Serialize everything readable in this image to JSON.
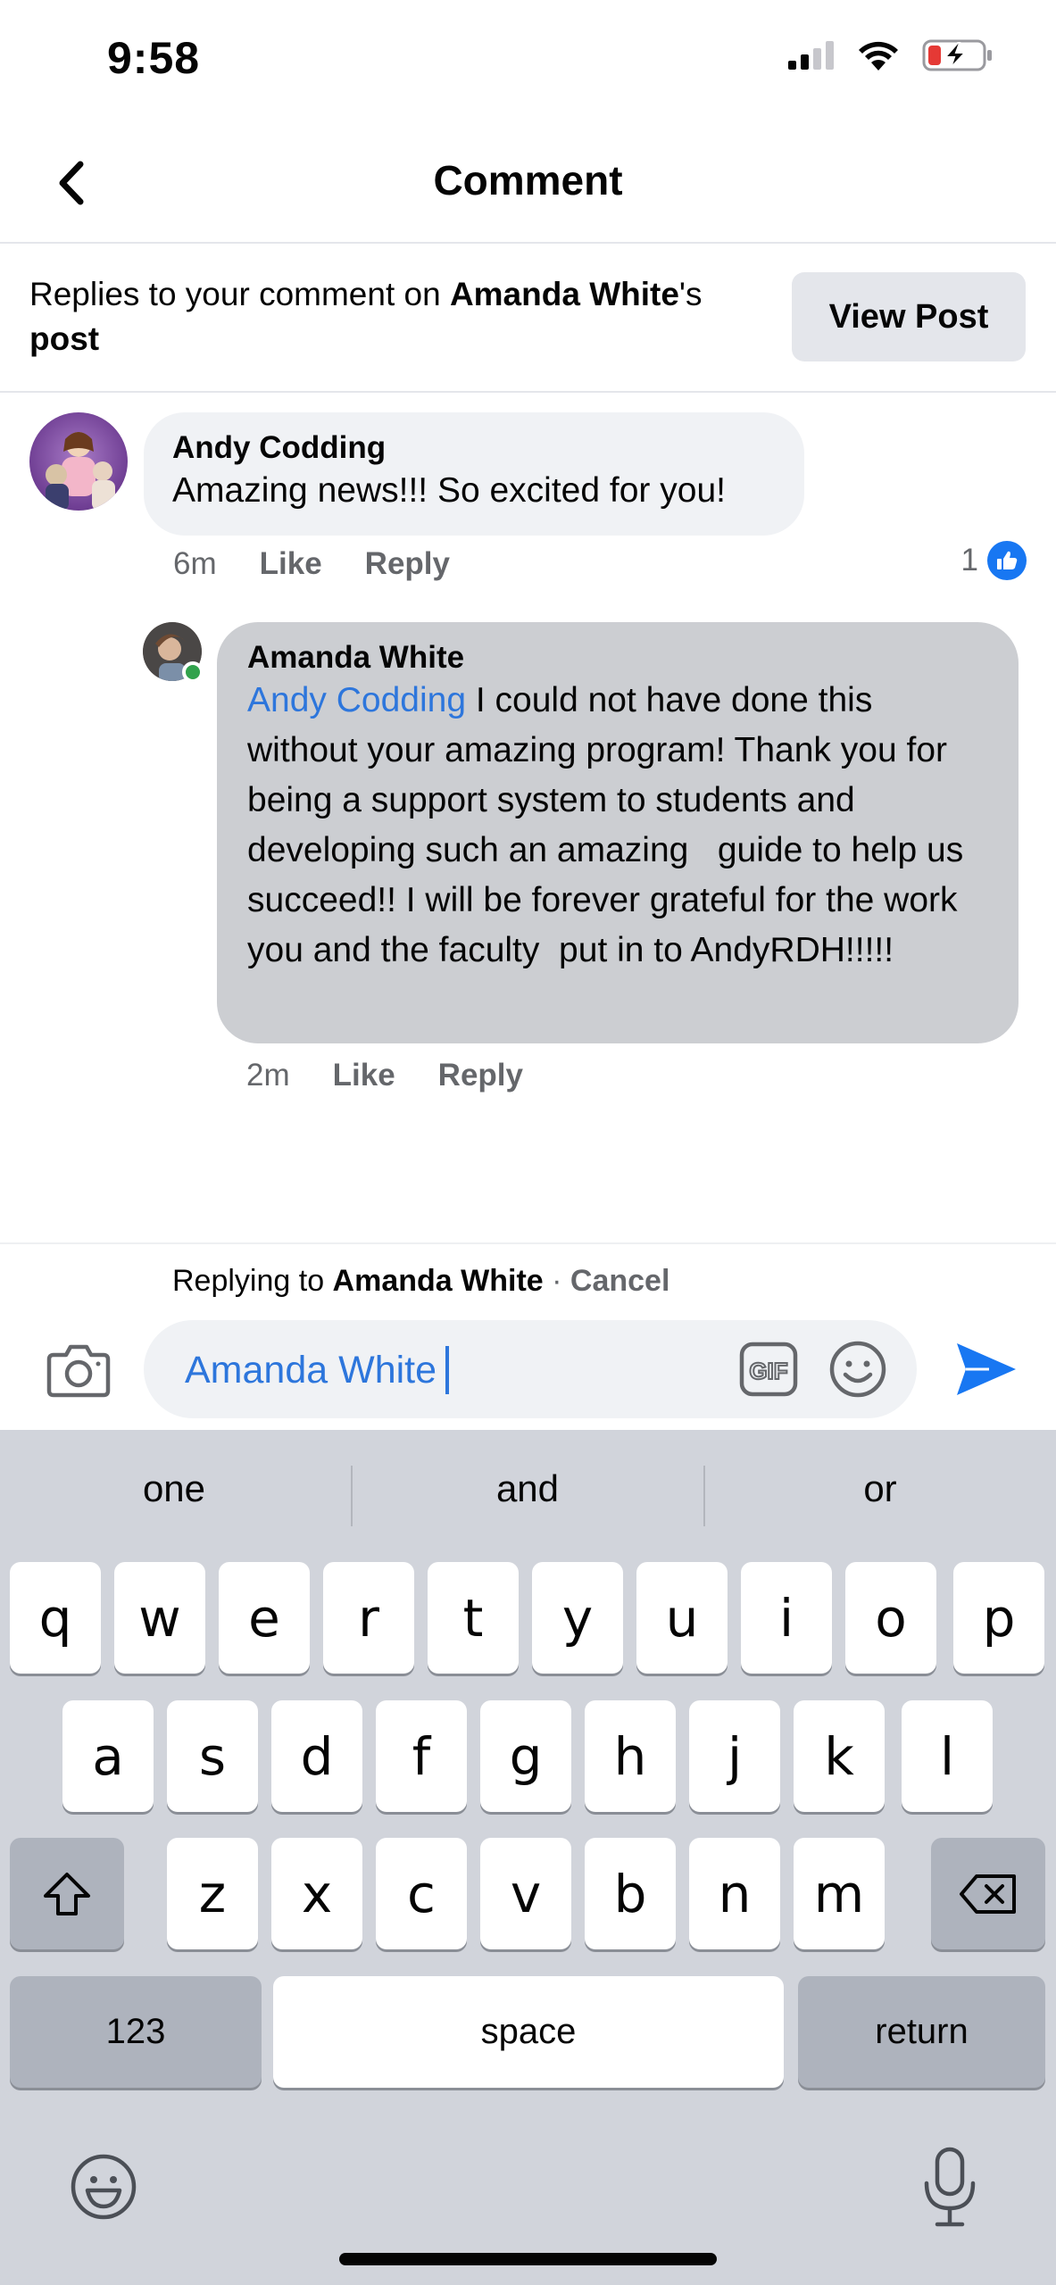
{
  "status_bar": {
    "time": "9:58"
  },
  "header": {
    "title": "Comment"
  },
  "context": {
    "prefix": "Replies to your comment on ",
    "post_owner": "Amanda White",
    "suffix": "'s ",
    "post_word": "post",
    "view_post_label": "View Post"
  },
  "comments": [
    {
      "author": "Andy Codding",
      "text": "Amazing news!!! So excited for you!",
      "time": "6m",
      "like_label": "Like",
      "reply_label": "Reply",
      "like_count": "1"
    },
    {
      "author": "Amanda White",
      "mention": "Andy Codding",
      "text": " I could not have done this without your amazing program! Thank you for being a support system to students and developing such an amazing   guide to help us succeed!! I will be forever grateful for the work you and the faculty  put in to AndyRDH!!!!!",
      "time": "2m",
      "like_label": "Like",
      "reply_label": "Reply"
    }
  ],
  "composer": {
    "replying_prefix": "Replying to ",
    "replying_to": "Amanda White",
    "separator": " · ",
    "cancel_label": "Cancel",
    "input_value": "Amanda White"
  },
  "keyboard": {
    "suggestions": [
      "one",
      "and",
      "or"
    ],
    "row1": [
      "q",
      "w",
      "e",
      "r",
      "t",
      "y",
      "u",
      "i",
      "o",
      "p"
    ],
    "row2": [
      "a",
      "s",
      "d",
      "f",
      "g",
      "h",
      "j",
      "k",
      "l"
    ],
    "row3": [
      "z",
      "x",
      "c",
      "v",
      "b",
      "n",
      "m"
    ],
    "numbers_label": "123",
    "space_label": "space",
    "return_label": "return"
  },
  "colors": {
    "accent": "#1877f2",
    "mention": "#2d76dc",
    "bubble": "#f0f2f5",
    "bubble_selected": "#ccced2",
    "keyboard_bg": "#d1d4db"
  }
}
